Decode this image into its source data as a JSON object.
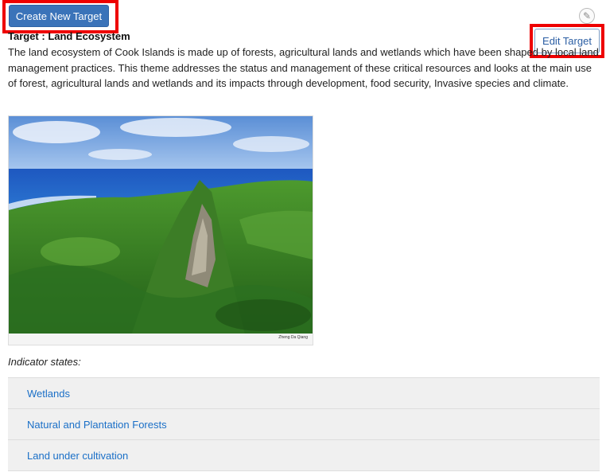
{
  "toolbar": {
    "create_label": "Create New Target",
    "edit_label": "Edit Target"
  },
  "target": {
    "title": "Target : Land Ecosystem",
    "description": "The land ecosystem of Cook Islands is made up of forests, agricultural lands and wetlands which have been shaped by local land management practices. This theme addresses the status and management of these critical resources and looks at the main use of forest, agricultural lands and wetlands and its impacts through development, food security, Invasive species and climate.",
    "image_caption": "Zheng Da Qiang"
  },
  "indicators": {
    "label": "Indicator states:",
    "items": [
      {
        "label": "Wetlands"
      },
      {
        "label": "Natural and Plantation Forests"
      },
      {
        "label": "Land under cultivation"
      }
    ]
  },
  "colors": {
    "primary": "#3a73b9",
    "link": "#1a6fc7",
    "highlight": "#ee0000"
  },
  "icons": {
    "edit": "pencil-icon"
  }
}
